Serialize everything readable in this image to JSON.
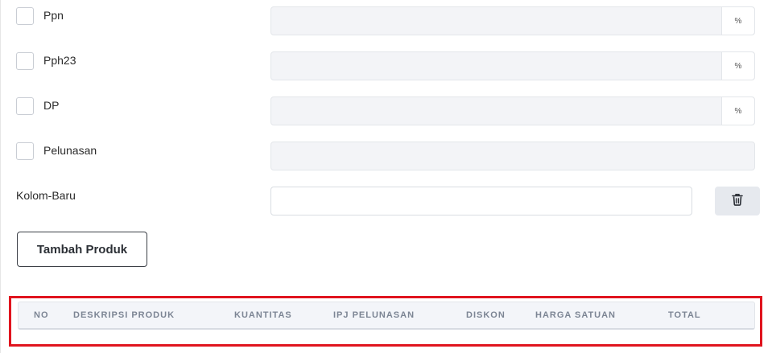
{
  "rows": [
    {
      "label": "Ppn",
      "has_checkbox": true,
      "suffix": "%"
    },
    {
      "label": "Pph23",
      "has_checkbox": true,
      "suffix": "%"
    },
    {
      "label": "DP",
      "has_checkbox": true,
      "suffix": "%"
    },
    {
      "label": "Pelunasan",
      "has_checkbox": true,
      "suffix": ""
    }
  ],
  "new_column": {
    "label": "Kolom-Baru",
    "value": "",
    "delete_icon": "trash-icon"
  },
  "add_product_button": "Tambah Produk",
  "table": {
    "columns": [
      "NO",
      "DESKRIPSI PRODUK",
      "KUANTITAS",
      "IPJ PELUNASAN",
      "DISKON",
      "HARGA SATUAN",
      "TOTAL"
    ]
  },
  "colors": {
    "highlight": "#e0141e",
    "header_bg": "#f3f5f9",
    "header_text": "#7c8594"
  }
}
